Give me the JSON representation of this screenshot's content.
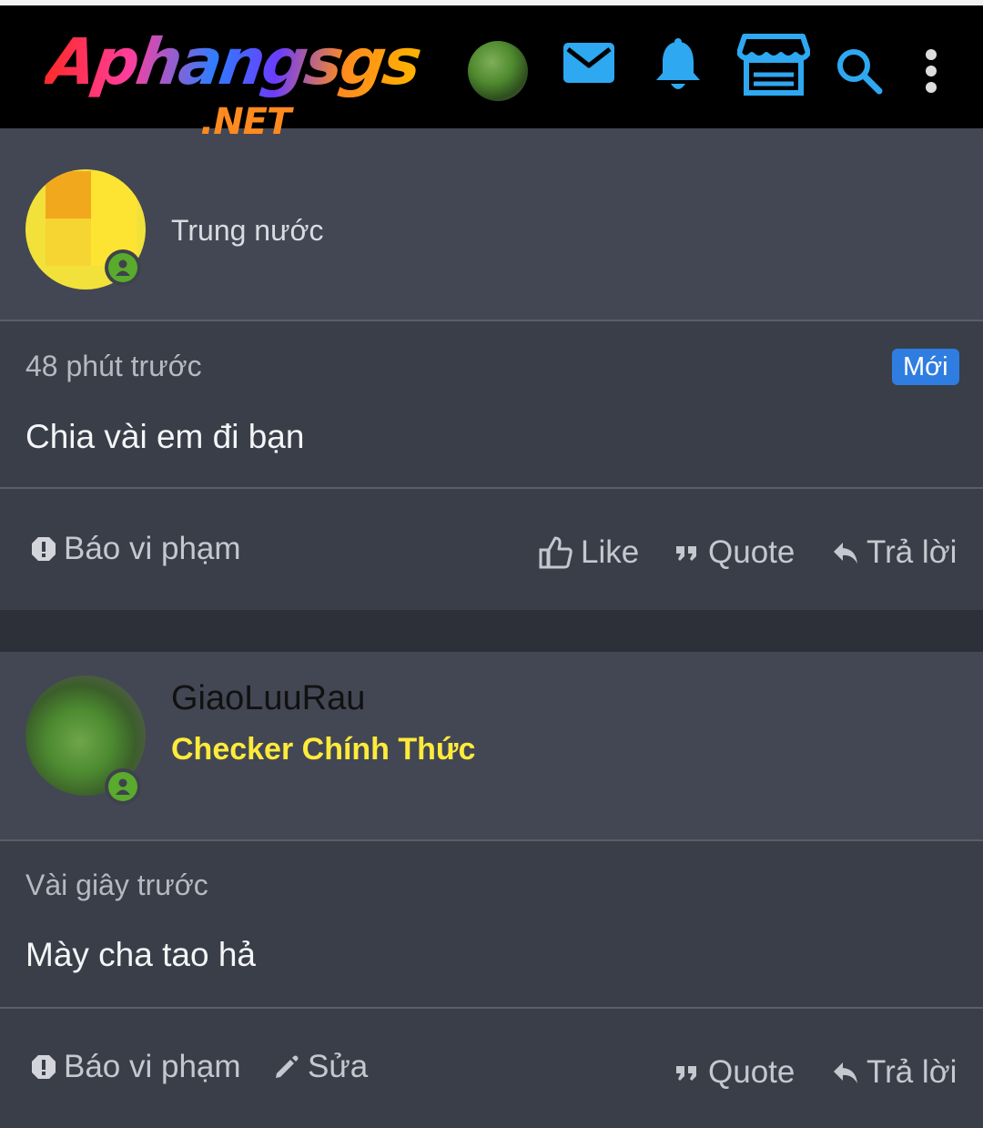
{
  "site": {
    "logo_main": "Aphangsgs",
    "logo_sub": ".NET"
  },
  "navbar": {
    "icons": [
      "user-avatar",
      "mail-icon",
      "bell-icon",
      "store-icon",
      "search-icon",
      "more-vertical-icon"
    ]
  },
  "posts": [
    {
      "username": "",
      "subtitle": "Trung nước",
      "time": "48 phút trước",
      "badge": "Mới",
      "message": "Chia vài em đi bạn",
      "actions": {
        "report": "Báo vi phạm",
        "like": "Like",
        "quote": "Quote",
        "reply": "Trả lời"
      }
    },
    {
      "username": "GiaoLuuRau",
      "rank": "Checker Chính Thức",
      "time": "Vài giây trước",
      "message": "Mày cha tao hả",
      "actions": {
        "report": "Báo vi phạm",
        "edit": "Sửa",
        "quote": "Quote",
        "reply": "Trả lời"
      }
    }
  ],
  "colors": {
    "navbar": "#000000",
    "icon_accent": "#2ea8f0",
    "rank": "#ffeb3b",
    "online": "#5aaa2d",
    "badge": "#2f7de0"
  }
}
